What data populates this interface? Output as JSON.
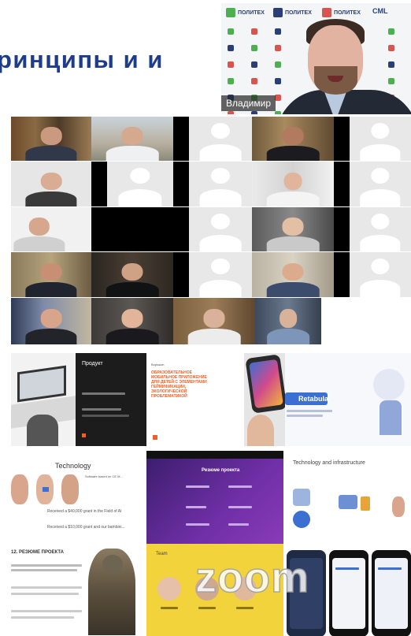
{
  "slide": {
    "title": "ринципы и и"
  },
  "speaker": {
    "name": "Владимир",
    "logos": [
      {
        "label": "ПОЛИТЕХ",
        "color": "#4caf50"
      },
      {
        "label": "ПОЛИТЕХ",
        "color": "#2a3f77"
      },
      {
        "label": "ПОЛИТЕХ",
        "color": "#d9534f"
      },
      {
        "label": "CML",
        "color": "#2a3f77"
      }
    ]
  },
  "mosaic": {
    "product_title": "Продукт",
    "pitch_heading": "ОБРАЗОВАТЕЛЬНОЕ МОБИЛЬНОЕ ПРИЛОЖЕНИЕ ДЛЯ ДЕТЕЙ С ЭЛЕМЕНТАМИ ГЕЙМИФИКАЦИИ, ЭКОЛОГИЧЕСКОЙ ПРОБЛЕМАТИКОЙ",
    "retabula_label": "Retabula",
    "technology_title": "Technology",
    "tech_lines": [
      "Software based on CE M...",
      "Received a $40,000 grant in the Field of AI",
      "Received a $10,000 grant and our bambini..."
    ],
    "resume_title": "Резюме проекта",
    "tech_infra_title": "Technology and infrastructure",
    "resume_label": "12. РЕЗЮМЕ ПРОЕКТА",
    "team_title": "Team",
    "zoom_watermark": "zoom"
  },
  "colors": {
    "title_blue": "#1e3c8c",
    "product_bg": "#1c1c1c",
    "pitch_orange": "#e8632b",
    "purple_slide": "#5b2a91",
    "team_yellow": "#f3d33b"
  }
}
